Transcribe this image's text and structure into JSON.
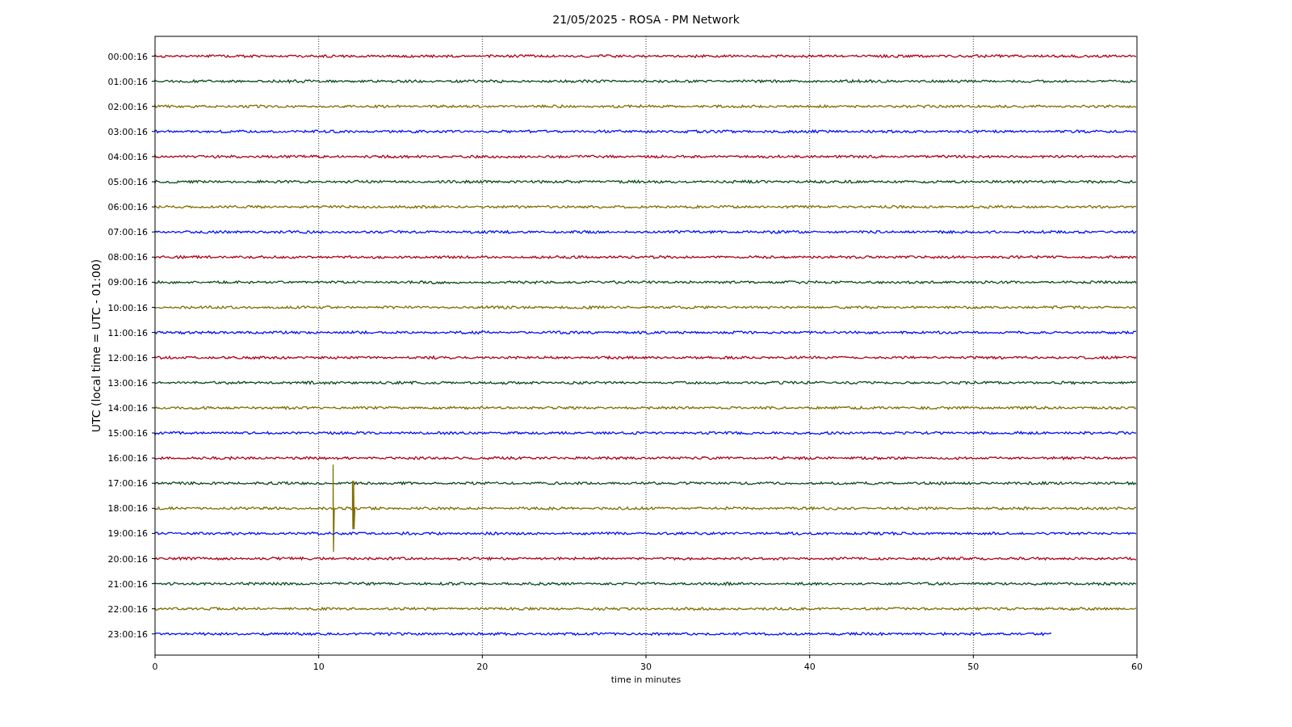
{
  "title": "21/05/2025 - ROSA - PM Network",
  "ylabel": "UTC (local time = UTC - 01:00)",
  "xlabel": "time in minutes",
  "xticks": [
    "0",
    "10",
    "20",
    "30",
    "40",
    "50",
    "60"
  ],
  "rows": [
    {
      "label": "00:00:16",
      "color": "#b00018",
      "level": 1
    },
    {
      "label": "01:00:16",
      "color": "#0b4d1b",
      "level": 1
    },
    {
      "label": "02:00:16",
      "color": "#7f6e00",
      "level": 1
    },
    {
      "label": "03:00:16",
      "color": "#0010ff",
      "level": 1
    },
    {
      "label": "04:00:16",
      "color": "#b00018",
      "level": 1
    },
    {
      "label": "05:00:16",
      "color": "#0b4d1b",
      "level": 1
    },
    {
      "label": "06:00:16",
      "color": "#7f6e00",
      "level": 1
    },
    {
      "label": "07:00:16",
      "color": "#0010ff",
      "level": 1
    },
    {
      "label": "08:00:16",
      "color": "#b00018",
      "level": 1
    },
    {
      "label": "09:00:16",
      "color": "#0b4d1b",
      "level": 1
    },
    {
      "label": "10:00:16",
      "color": "#7f6e00",
      "level": 1
    },
    {
      "label": "11:00:16",
      "color": "#0010ff",
      "level": 1
    },
    {
      "label": "12:00:16",
      "color": "#b00018",
      "level": 1
    },
    {
      "label": "13:00:16",
      "color": "#0b4d1b",
      "level": 1
    },
    {
      "label": "14:00:16",
      "color": "#7f6e00",
      "level": 1
    },
    {
      "label": "15:00:16",
      "color": "#0010ff",
      "level": 1
    },
    {
      "label": "16:00:16",
      "color": "#b00018",
      "level": 1
    },
    {
      "label": "17:00:16",
      "color": "#0b4d1b",
      "level": 1
    },
    {
      "label": "18:00:16",
      "color": "#7f6e00",
      "level": 1
    },
    {
      "label": "19:00:16",
      "color": "#0010ff",
      "level": 1
    },
    {
      "label": "20:00:16",
      "color": "#b00018",
      "level": 1
    },
    {
      "label": "21:00:16",
      "color": "#0b4d1b",
      "level": 1
    },
    {
      "label": "22:00:16",
      "color": "#7f6e00",
      "level": 1
    },
    {
      "label": "23:00:16",
      "color": "#0010ff",
      "level": 0.913
    }
  ]
}
